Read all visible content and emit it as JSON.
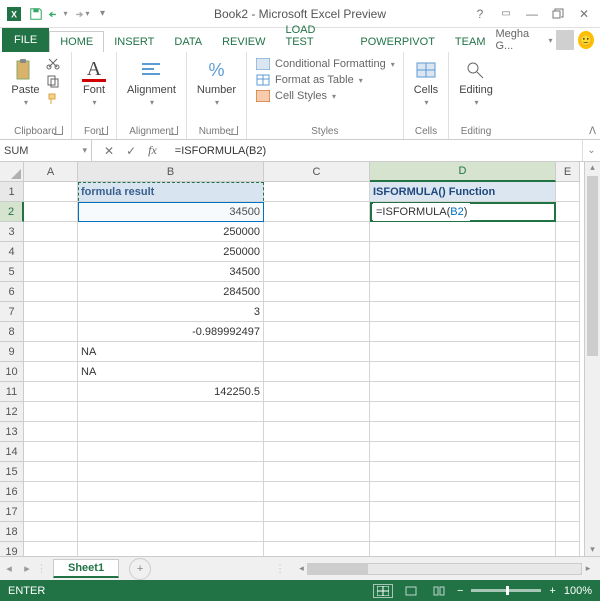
{
  "title": "Book2 - Microsoft Excel Preview",
  "tabs": {
    "file": "FILE",
    "home": "HOME",
    "insert": "INSERT",
    "data": "DATA",
    "review": "REVIEW",
    "loadtest": "LOAD TEST",
    "powerpivot": "POWERPIVOT",
    "team": "TEAM"
  },
  "user": "Megha G...",
  "ribbon": {
    "clipboard": {
      "paste": "Paste",
      "label": "Clipboard"
    },
    "font": {
      "btn": "Font",
      "label": "Font"
    },
    "align": {
      "btn": "Alignment",
      "label": "Alignment"
    },
    "number": {
      "btn": "Number",
      "label": "Number"
    },
    "styles": {
      "cf": "Conditional Formatting",
      "fat": "Format as Table",
      "cs": "Cell Styles",
      "label": "Styles"
    },
    "cells": {
      "btn": "Cells",
      "label": "Cells"
    },
    "editing": {
      "btn": "Editing",
      "label": "Editing"
    }
  },
  "namebox": "SUM",
  "formula": "=ISFORMULA(B2)",
  "cols": {
    "A": "A",
    "B": "B",
    "C": "C",
    "D": "D",
    "E": "E"
  },
  "colw": {
    "A": 54,
    "B": 186,
    "C": 106,
    "D": 186,
    "E": 24
  },
  "rows": [
    "1",
    "2",
    "3",
    "4",
    "5",
    "6",
    "7",
    "8",
    "9",
    "10",
    "11",
    "12",
    "13",
    "14",
    "15",
    "16",
    "17",
    "18",
    "19"
  ],
  "cells": {
    "B1": "formula result",
    "D1": "ISFORMULA() Function",
    "B2": "34500",
    "B3": "250000",
    "B4": "250000",
    "B5": "34500",
    "B6": "284500",
    "B7": "3",
    "B8": "-0.989992497",
    "B9": "NA",
    "B10": "NA",
    "B11": "142250.5"
  },
  "d2": {
    "pre": "=ISFORMULA(",
    "ref": "B2",
    "post": ")"
  },
  "sheet": "Sheet1",
  "status": "ENTER",
  "zoom": "100%"
}
